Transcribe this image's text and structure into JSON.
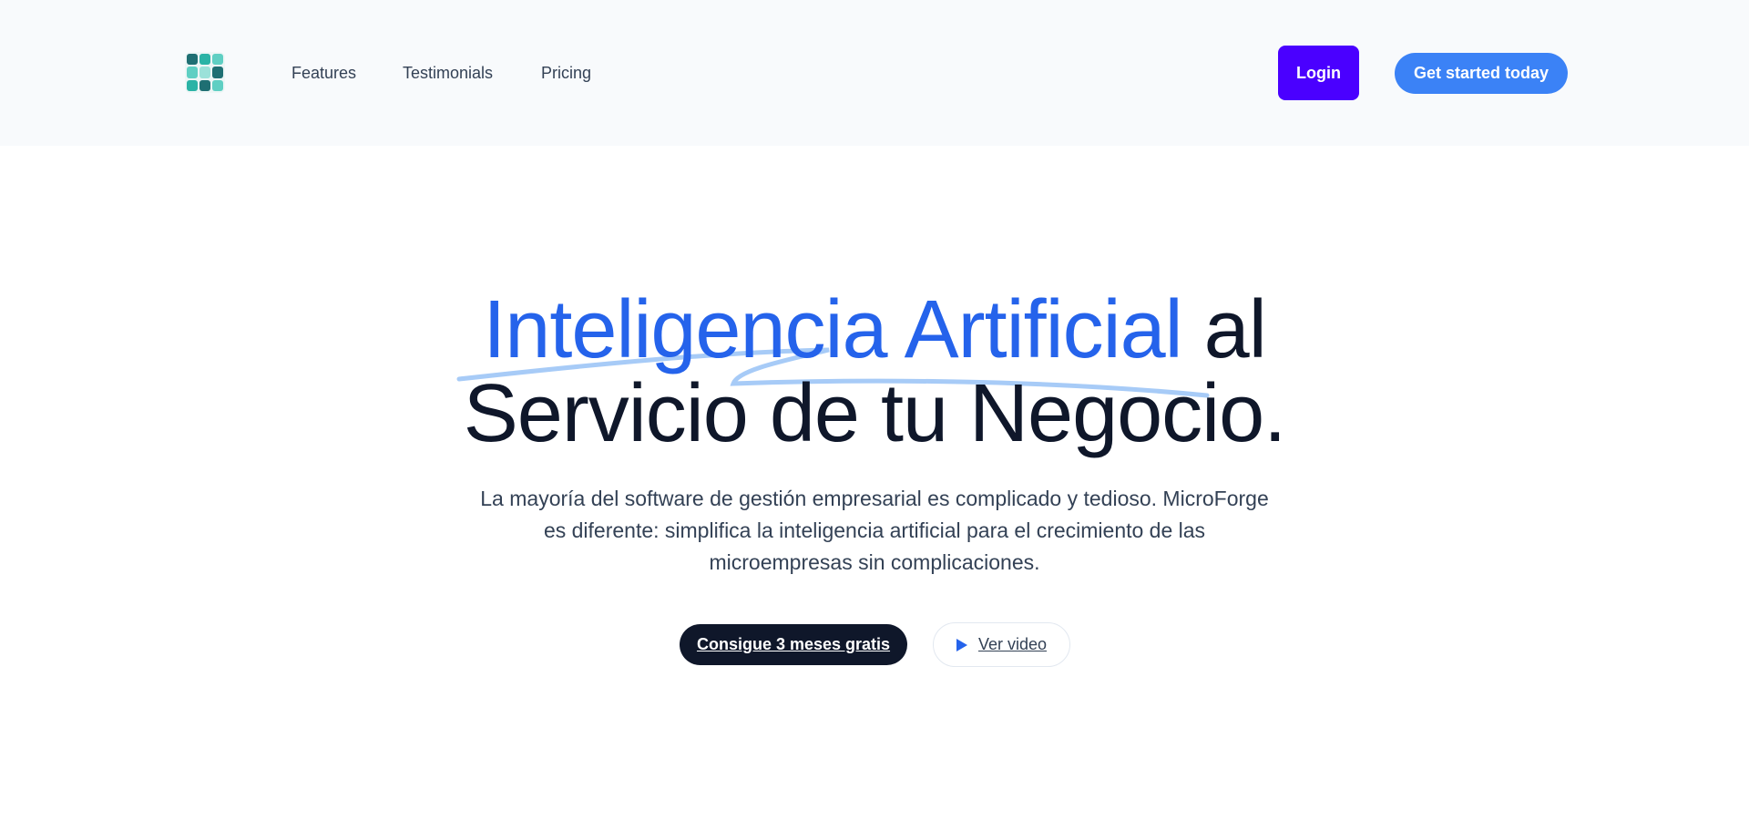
{
  "brand": {
    "logo_icon": "microforge-logo-icon"
  },
  "nav": {
    "items": [
      {
        "label": "Features"
      },
      {
        "label": "Testimonials"
      },
      {
        "label": "Pricing"
      }
    ]
  },
  "header": {
    "login_label": "Login",
    "get_started_label": "Get started today"
  },
  "hero": {
    "title_accent": "Inteligencia Artificial",
    "title_rest_line1": " al",
    "title_line2": "Servicio de tu Negocio.",
    "subtitle": "La mayoría del software de gestión empresarial es complicado y tedioso. MicroForge es diferente: simplifica la inteligencia artificial para el crecimiento de las microempresas sin complicaciones.",
    "primary_cta": "Consigue 3 meses gratis",
    "video_cta": "Ver video",
    "video_icon": "play-icon"
  },
  "colors": {
    "accent": "#2563eb",
    "login_button": "#4a00ff",
    "start_button": "#3b82f6",
    "primary_cta": "#0f172a",
    "header_bg": "#f8fafc"
  }
}
